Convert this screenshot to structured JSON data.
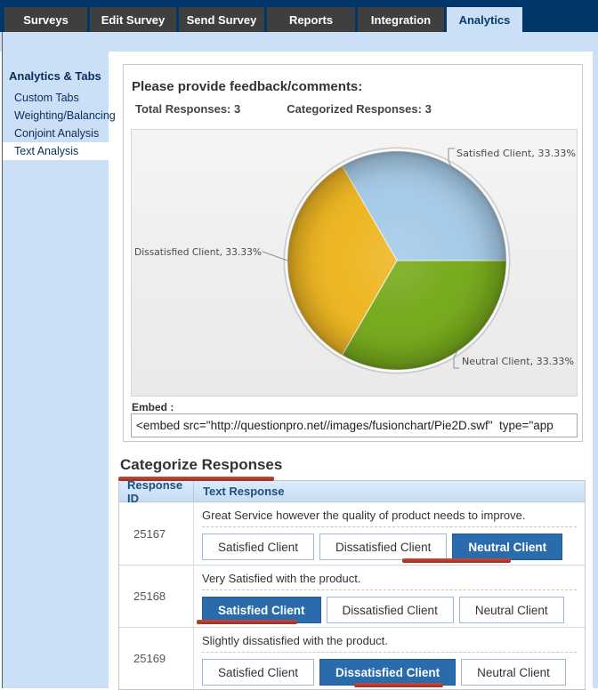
{
  "header": {
    "tabs": [
      {
        "label": "Surveys",
        "active": false
      },
      {
        "label": "Edit Survey",
        "active": false
      },
      {
        "label": "Send Survey",
        "active": false
      },
      {
        "label": "Reports",
        "active": false
      },
      {
        "label": "Integration",
        "active": false
      },
      {
        "label": "Analytics",
        "active": true
      }
    ]
  },
  "sidebar": {
    "title": "Analytics & Tabs",
    "items": [
      {
        "label": "Custom Tabs",
        "selected": false
      },
      {
        "label": "Weighting/Balancing",
        "selected": false
      },
      {
        "label": "Conjoint Analysis",
        "selected": false
      },
      {
        "label": "Text Analysis",
        "selected": true
      }
    ]
  },
  "feedback_panel": {
    "title": "Please provide feedback/comments:",
    "total_responses_label": "Total Responses:",
    "total_responses_value": "3",
    "categorized_responses_label": "Categorized Responses:",
    "categorized_responses_value": "3",
    "embed_label": "Embed :",
    "embed_value": "<embed src=\"http://questionpro.net//images/fusionchart/Pie2D.swf\"  type=\"app"
  },
  "chart_data": {
    "type": "pie",
    "labels": [
      "Satisfied Client",
      "Dissatisfied Client",
      "Neutral Client"
    ],
    "values": [
      33.33,
      33.33,
      33.33
    ],
    "colors": [
      "#a6cbe8",
      "#eeb623",
      "#77aa1d"
    ],
    "label_format": "{label}, {value}%",
    "start_angle_deg": 0,
    "direction": "counterclockwise",
    "legend": "callout-labels",
    "title": ""
  },
  "categorize": {
    "title": "Categorize Responses",
    "columns": [
      "Response ID",
      "Text Response"
    ],
    "categories": [
      "Satisfied Client",
      "Dissatisfied Client",
      "Neutral Client"
    ],
    "rows": [
      {
        "id": "25167",
        "text": "Great Service however the quality of product needs to improve.",
        "selected_category": "Neutral Client"
      },
      {
        "id": "25168",
        "text": "Very Satisfied with the product.",
        "selected_category": "Satisfied Client"
      },
      {
        "id": "25169",
        "text": "Slightly dissatisfied with the product.",
        "selected_category": "Dissatisfied Client"
      }
    ]
  },
  "colors": {
    "navy": "#003768",
    "tab_gray": "#3f3f3f",
    "light_blue": "#cbdff7",
    "selected_button_blue": "#2a6cab",
    "annotation_red": "#b03a2e"
  }
}
